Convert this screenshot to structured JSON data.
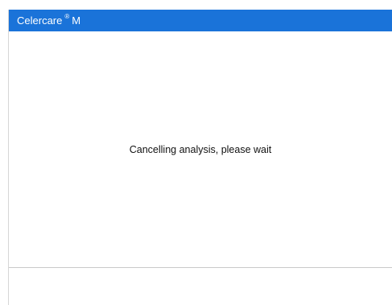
{
  "app": {
    "name": "Celercare",
    "registered_mark": "®",
    "model": "M"
  },
  "status": {
    "message": "Cancelling analysis, please wait"
  },
  "colors": {
    "titlebar_bg": "#1a73d9",
    "background": "#ffffff"
  }
}
